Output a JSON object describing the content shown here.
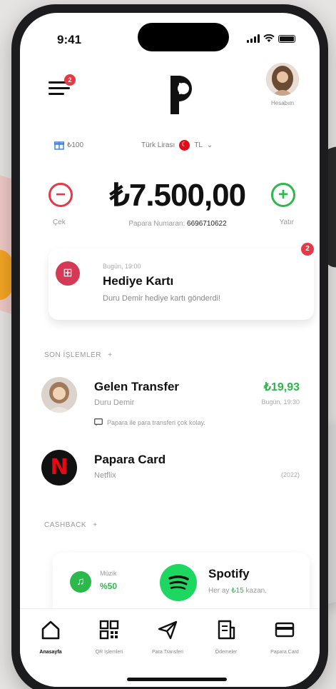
{
  "status_bar": {
    "time": "9:41"
  },
  "header": {
    "menu_badge": "2",
    "profile_label": "Hesabım"
  },
  "info_row": {
    "gift_value": "₺100",
    "currency_label": "Türk Lirası",
    "currency_code": "TL"
  },
  "balance": {
    "amount": "₺7.500,00",
    "minus_label": "Çek",
    "plus_label": "Yatır",
    "papara_number_label": "Papara Numaran:",
    "papara_number": "6696710622"
  },
  "gift_notification": {
    "time": "Bugün, 19:00",
    "title": "Hediye Kartı",
    "description": "Duru Demir hediye kartı gönderdi!",
    "badge": "2"
  },
  "transactions_section": {
    "label": "SON İŞLEMLER",
    "plus": "+"
  },
  "transactions": [
    {
      "title": "Gelen Transfer",
      "subtitle": "Duru Demir",
      "amount": "₺19,93",
      "time": "Bugün, 19:30",
      "note": "Papara ile para transferi çok kolay."
    },
    {
      "title": "Papara Card",
      "subtitle": "Netflix",
      "amount": "",
      "time": "(2022)"
    }
  ],
  "cashback_section": {
    "label": "CASHBACK",
    "plus": "+"
  },
  "cashback": {
    "category_label": "Müzik",
    "category_pct": "%50",
    "brand_title": "Spotify",
    "brand_sub_prefix": "Her ay",
    "brand_sub_amount": "₺15",
    "brand_sub_suffix": "kazan."
  },
  "tabbar": {
    "tabs": [
      {
        "label": "Anasayfa",
        "icon": "home-icon"
      },
      {
        "label": "QR İşlemleri",
        "icon": "qr-icon"
      },
      {
        "label": "Para Transferi",
        "icon": "send-icon"
      },
      {
        "label": "Ödemeler",
        "icon": "bill-icon"
      },
      {
        "label": "Papara Card",
        "icon": "card-icon"
      }
    ]
  },
  "colors": {
    "accent_green": "#2db84b",
    "accent_red": "#e63946",
    "spotify_green": "#1ed760"
  }
}
